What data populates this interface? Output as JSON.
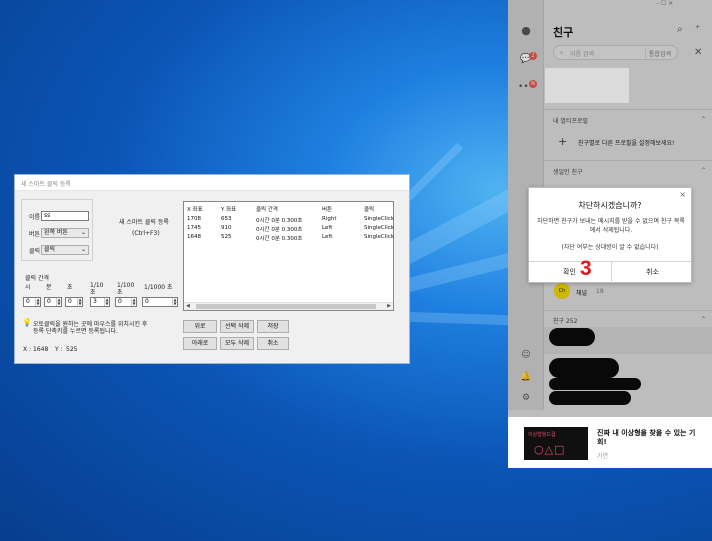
{
  "smart_click": {
    "window_title": "새 스마트 클릭 등록",
    "name_label": "이름",
    "name_value": "ss",
    "button_label": "버튼",
    "button_value": "왼쪽 버튼",
    "click_label": "클릭",
    "click_value": "클릭",
    "register_title": "새 스마트 클릭 등록",
    "register_shortcut": "(Ctrl+F3)",
    "interval_label": "클릭 간격",
    "interval_units": [
      "시",
      "분",
      "초",
      "1/10 초",
      "1/100 초",
      "1/1000 초"
    ],
    "interval_values": [
      "0",
      "0",
      "0",
      "3",
      "0",
      "0"
    ],
    "hint_text_1": "오토클릭을 원하는 곳에 마우스를 위치시킨 후",
    "hint_text_2": "등록 단축키를 누르면 등록됩니다.",
    "x_label": "X :",
    "x_value": "1648",
    "y_label": "Y :",
    "y_value": "525",
    "columns": [
      "X 좌표",
      "Y 좌표",
      "클릭 간격",
      "버튼",
      "클릭"
    ],
    "rows": [
      [
        "1708",
        "653",
        "0시간 0분 0.300초",
        "Right",
        "SingleClick"
      ],
      [
        "1745",
        "910",
        "0시간 0분 0.300초",
        "Left",
        "SingleClick"
      ],
      [
        "1648",
        "525",
        "0시간 0분 0.300초",
        "Left",
        "SingleClick"
      ]
    ],
    "buttons": {
      "up": "위로",
      "delete_selected": "선택 삭제",
      "save": "저장",
      "down": "아래로",
      "delete_all": "모두 삭제",
      "cancel": "취소"
    }
  },
  "kakao": {
    "title": "친구",
    "search_placeholder": "이름 검색",
    "search_scope": "통합검색",
    "badge_chat": "2",
    "badge_more": "N",
    "multiprofile_section": "내 멀티프로필",
    "multiprofile_text": "친구별로 다른 프로필을 설정해보세요!",
    "birthday_section": "생일인 친구",
    "channel_name": "채널",
    "channel_count": "18",
    "friends_section": "친구 252",
    "ad_title": "진짜 내 이상형을 찾을 수 있는 기회!",
    "ad_sub": "가연",
    "ad_image_text": "이상형월드컵"
  },
  "dialog": {
    "title": "차단하시겠습니까?",
    "body": "차단하면 친구가 보내는 메시지를 받을 수 없으며 친구 목록에서 삭제됩니다.",
    "note": "(차단 여부는 상대방이 알 수 없습니다)",
    "confirm": "확인",
    "cancel": "취소"
  },
  "annotation": "3"
}
